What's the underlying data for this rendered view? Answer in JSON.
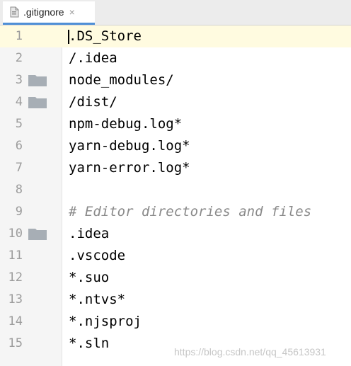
{
  "tab": {
    "filename": ".gitignore",
    "close_glyph": "×",
    "icon": "file-icon"
  },
  "lines": [
    {
      "number": "1",
      "text": ".DS_Store",
      "type": "code",
      "folder": false,
      "current": true
    },
    {
      "number": "2",
      "text": "/.idea",
      "type": "code",
      "folder": false
    },
    {
      "number": "3",
      "text": "node_modules/",
      "type": "code",
      "folder": true
    },
    {
      "number": "4",
      "text": "/dist/",
      "type": "code",
      "folder": true
    },
    {
      "number": "5",
      "text": "npm-debug.log*",
      "type": "code",
      "folder": false
    },
    {
      "number": "6",
      "text": "yarn-debug.log*",
      "type": "code",
      "folder": false
    },
    {
      "number": "7",
      "text": "yarn-error.log*",
      "type": "code",
      "folder": false
    },
    {
      "number": "8",
      "text": "",
      "type": "code",
      "folder": false
    },
    {
      "number": "9",
      "text": "# Editor directories and files",
      "type": "comment",
      "folder": false
    },
    {
      "number": "10",
      "text": ".idea",
      "type": "code",
      "folder": true
    },
    {
      "number": "11",
      "text": ".vscode",
      "type": "code",
      "folder": false
    },
    {
      "number": "12",
      "text": "*.suo",
      "type": "code",
      "folder": false
    },
    {
      "number": "13",
      "text": "*.ntvs*",
      "type": "code",
      "folder": false
    },
    {
      "number": "14",
      "text": "*.njsproj",
      "type": "code",
      "folder": false
    },
    {
      "number": "15",
      "text": "*.sln",
      "type": "code",
      "folder": false
    }
  ],
  "watermark": "https://blog.csdn.net/qq_45613931",
  "colors": {
    "folder": "#a7aeb5",
    "tab_underline": "#4f8fd6",
    "comment": "#8a8a8a",
    "current_line": "#fffbe0"
  }
}
